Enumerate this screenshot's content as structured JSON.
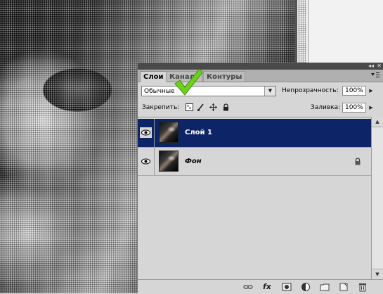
{
  "panel": {
    "tabs": [
      {
        "label": "Слои",
        "active": true
      },
      {
        "label": "Канал",
        "active": false
      },
      {
        "label": "Контуры",
        "active": false
      }
    ],
    "panel_controls": "◂◂ ✕",
    "menu_icon": "panel-menu-icon",
    "blend_mode": {
      "value": "Обычные",
      "arrow": "▼"
    },
    "opacity": {
      "label": "Непрозрачность:",
      "value": "100%",
      "arrow": "▶"
    },
    "lock": {
      "label": "Закрепить:"
    },
    "fill": {
      "label": "Заливка:",
      "value": "100%",
      "arrow": "▶"
    },
    "layers": [
      {
        "name": "Слой 1",
        "selected": true,
        "locked": false,
        "visible": true
      },
      {
        "name": "Фон",
        "selected": false,
        "locked": true,
        "visible": true
      }
    ],
    "scroll": {
      "up": "▲",
      "down": "▼"
    },
    "bottom_icons": [
      "link-icon",
      "fx-icon",
      "mask-icon",
      "adjustment-icon",
      "folder-icon",
      "new-layer-icon",
      "trash-icon"
    ],
    "fx_label": "fx"
  },
  "colors": {
    "selected_row": "#0d2466",
    "panel_bg": "#d6d6d6",
    "checkmark": "#6fcf1f"
  }
}
